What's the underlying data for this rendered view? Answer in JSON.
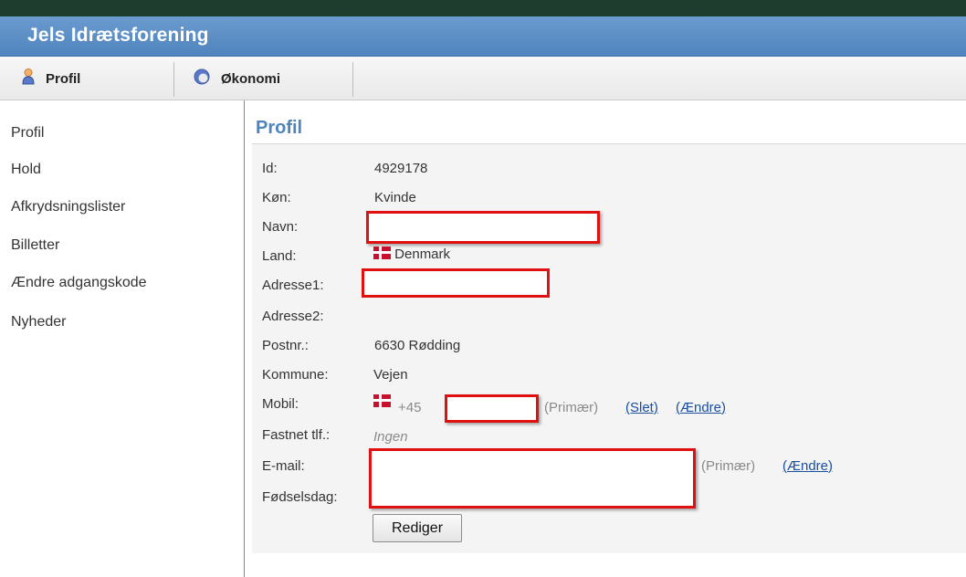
{
  "header": {
    "title": "Jels Idrætsforening"
  },
  "nav": {
    "tabs": [
      {
        "label": "Profil",
        "icon": "person-icon"
      },
      {
        "label": "Økonomi",
        "icon": "economy-icon"
      }
    ]
  },
  "sidebar": {
    "items": [
      {
        "label": "Profil"
      },
      {
        "label": "Hold"
      },
      {
        "label": "Afkrydsningslister"
      },
      {
        "label": "Billetter"
      },
      {
        "label": "Ændre adgangskode"
      },
      {
        "label": "Nyheder"
      }
    ]
  },
  "profile": {
    "title": "Profil",
    "labels": {
      "id": "Id:",
      "gender": "Køn:",
      "name": "Navn:",
      "country": "Land:",
      "address1": "Adresse1:",
      "address2": "Adresse2:",
      "zip": "Postnr.:",
      "municipality": "Kommune:",
      "mobile": "Mobil:",
      "landline": "Fastnet tlf.:",
      "email": "E-mail:",
      "birthday": "Fødselsdag:"
    },
    "values": {
      "id": "4929178",
      "gender": "Kvinde",
      "country": "Denmark",
      "zip": "6630 Rødding",
      "municipality": "Vejen",
      "mobile_prefix": "+45",
      "landline": "Ingen"
    },
    "mobile_primary": "(Primær)",
    "mobile_delete": "(Slet)",
    "mobile_change_open": "(",
    "mobile_change": "Ændre",
    "mobile_change_close": ")",
    "email_primary": "(Primær)",
    "email_change_open": "(",
    "email_change": "Ændre",
    "email_change_close": ")",
    "edit_button": "Rediger"
  },
  "colors": {
    "header": "#4f84bd",
    "title": "#4f84bd",
    "link": "#1a4fa0",
    "redaction": "#e01010"
  }
}
